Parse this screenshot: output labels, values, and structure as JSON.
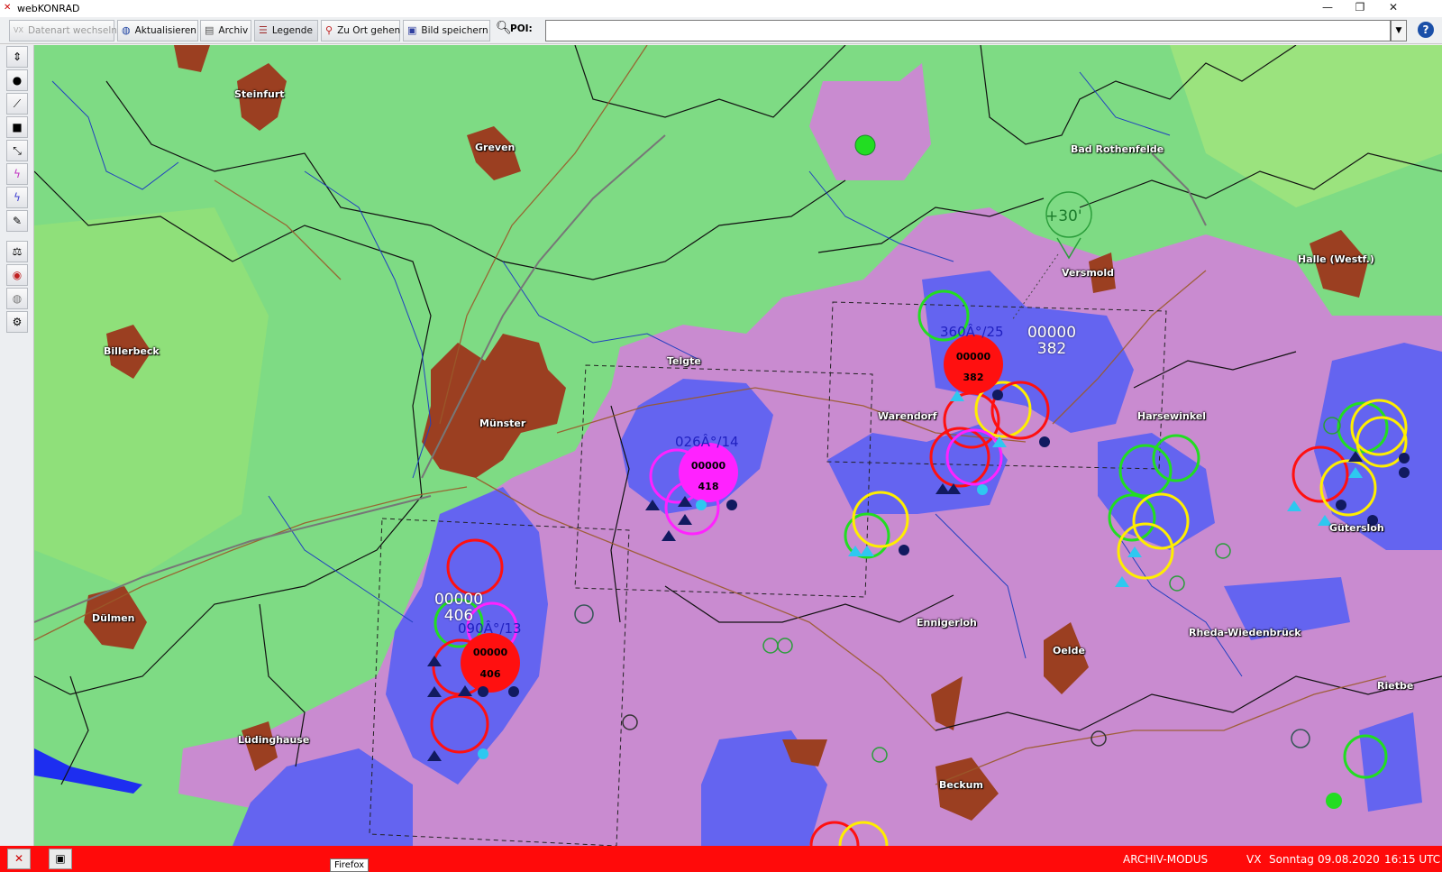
{
  "window": {
    "title": "webKONRAD",
    "minimize": "—",
    "restore": "❐",
    "close": "✕"
  },
  "toolbar": {
    "datenart": "Datenart wechseln",
    "aktualisieren": "Aktualisieren",
    "archiv": "Archiv",
    "legende": "Legende",
    "zu_ort": "Zu Ort gehen",
    "bild_speichern": "Bild speichern",
    "poi_label": "POI:",
    "poi_value": "",
    "help": "?"
  },
  "map": {
    "places": [
      {
        "name": "Steinfurt"
      },
      {
        "name": "Greven"
      },
      {
        "name": "Bad Rothenfelde"
      },
      {
        "name": "Versmold"
      },
      {
        "name": "Halle (Westf.)"
      },
      {
        "name": "Billerbeck"
      },
      {
        "name": "Telgte"
      },
      {
        "name": "Warendorf"
      },
      {
        "name": "Harsewinkel"
      },
      {
        "name": "Münster"
      },
      {
        "name": "Gütersloh"
      },
      {
        "name": "Dülmen"
      },
      {
        "name": "Ennigerloh"
      },
      {
        "name": "Oelde"
      },
      {
        "name": "Rheda-Wiedenbrück"
      },
      {
        "name": "Rietbe"
      },
      {
        "name": "Lüdinghause"
      },
      {
        "name": "Beckum"
      }
    ],
    "cells": [
      {
        "id": "telgte",
        "code": "00000",
        "value": "418",
        "vector": "026Â°/14",
        "color": "#ff22ff"
      },
      {
        "id": "warendorf",
        "code": "00000",
        "value": "382",
        "vector": "360Â°/25",
        "color": "#ff1010",
        "label_code": "00000",
        "label_value": "382"
      },
      {
        "id": "south",
        "code": "00000",
        "value": "406",
        "vector": "090Â°/13",
        "color": "#ff1010",
        "label_code": "00000",
        "label_value": "406"
      }
    ],
    "forecast": "+30'",
    "colors": {
      "green": "#7edb84",
      "pink": "#c98bd0",
      "blue": "#6464f0",
      "city": "#9b3f21",
      "red_cell": "#ff1010",
      "magenta_cell": "#ff22ff"
    }
  },
  "status": {
    "mode": "ARCHIV-MODUS",
    "vx": "VX",
    "day": "Sonntag",
    "date": "09.08.2020",
    "time": "16:15 UTC",
    "tooltip": "Firefox"
  }
}
